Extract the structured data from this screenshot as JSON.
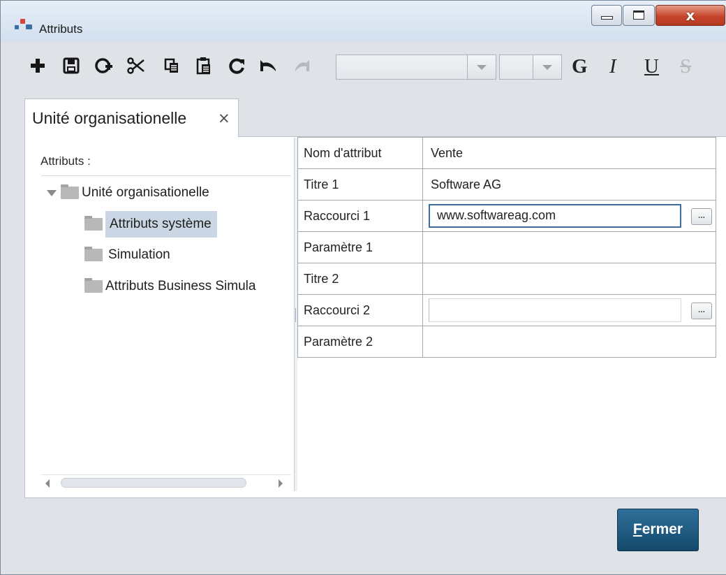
{
  "window": {
    "title": "Attributs",
    "close_glyph": "x",
    "brand_color": "#14496b"
  },
  "toolbar": {
    "icons": [
      "add-icon",
      "save-icon",
      "new-attribute-icon",
      "cut-icon",
      "copy-icon",
      "paste-icon",
      "redo-icon",
      "undo-icon",
      "repeat-icon"
    ],
    "font_combo_value": "",
    "size_combo_value": "",
    "bold_label": "G",
    "italic_label": "I",
    "underline_label": "U",
    "strike_label": "S"
  },
  "tab": {
    "label": "Unité organisationelle",
    "close_glyph": "×"
  },
  "left": {
    "label": "Attributs :",
    "tree": [
      {
        "label": "Unité organisationelle",
        "level": 0,
        "expanded": true
      },
      {
        "label": "Attributs système",
        "level": 1,
        "selected": true
      },
      {
        "label": "Simulation",
        "level": 1
      },
      {
        "label": "Attributs Business Simula",
        "level": 1
      }
    ]
  },
  "attributes": {
    "rows": [
      {
        "name": "Nom d'attribut",
        "value": "Vente"
      },
      {
        "name": "Titre 1",
        "value": "Software AG"
      },
      {
        "name": "Raccourci 1",
        "value": "www.softwareag.com"
      },
      {
        "name": "Paramètre 1",
        "value": ""
      },
      {
        "name": "Titre 2",
        "value": ""
      },
      {
        "name": "Raccourci 2",
        "value": ""
      },
      {
        "name": "Paramètre 2",
        "value": ""
      }
    ],
    "ellipsis_label": "..."
  },
  "footer": {
    "close_mnemonic": "F",
    "close_rest": "ermer"
  }
}
